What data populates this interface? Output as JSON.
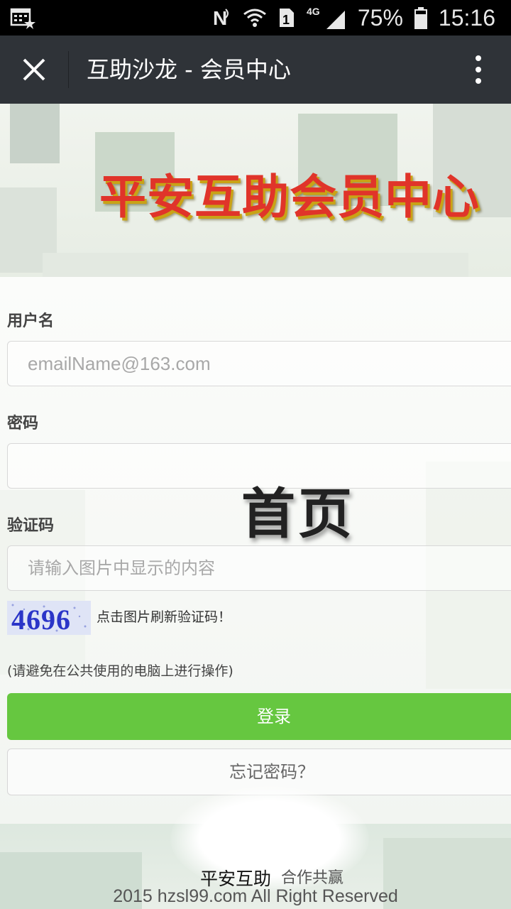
{
  "status_bar": {
    "icons": [
      "keyboard-icon",
      "nfc-icon",
      "wifi-icon",
      "sim-icon",
      "signal-icon",
      "battery-icon"
    ],
    "network": "4G",
    "sim": "1",
    "nfc": "N",
    "battery": "75%",
    "time": "15:16"
  },
  "title_bar": {
    "title": "互助沙龙 - 会员中心",
    "close_icon": "close-icon",
    "menu_icon": "more-vertical-icon"
  },
  "banner": {
    "title": "平安互助会员中心",
    "title_color": "#e0342a"
  },
  "form": {
    "username_label": "用户名",
    "username_placeholder": "emailName@163.com",
    "password_label": "密码",
    "captcha_label": "验证码",
    "captcha_placeholder": "请输入图片中显示的内容",
    "captcha_value": "4696",
    "captcha_tip": "点击图片刷新验证码！",
    "notice": "(请避免在公共使用的电脑上进行操作)",
    "login_button": "登录",
    "forgot_button": "忘记密码？"
  },
  "overlay": {
    "home_text": "首页"
  },
  "footer": {
    "brand": "平安互助",
    "slogan": "合作共赢",
    "copyright": "2015 hzsl99.com All Right Reserved"
  },
  "colors": {
    "status_bar_bg": "#000000",
    "title_bar_bg": "#2f3338",
    "login_button_bg": "#66c740"
  }
}
